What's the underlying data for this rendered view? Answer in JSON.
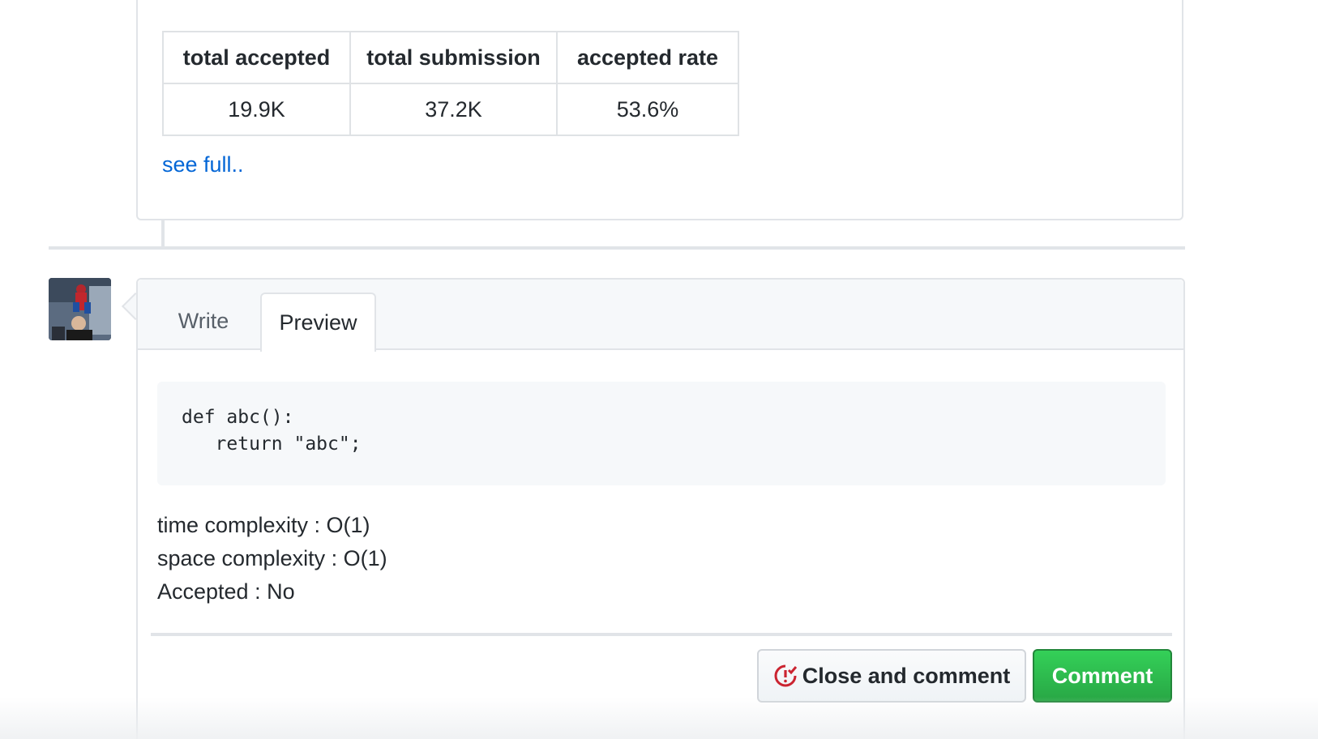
{
  "stats_table": {
    "headers": [
      "total accepted",
      "total submission",
      "accepted rate"
    ],
    "values": [
      "19.9K",
      "37.2K",
      "53.6%"
    ]
  },
  "see_full_link": "see full..",
  "comment_form": {
    "tabs": [
      "Write",
      "Preview"
    ],
    "active_tab": "Preview",
    "preview": {
      "code": "def abc():\n   return \"abc\";",
      "lines": [
        "time complexity : O(1)",
        "space complexity : O(1)",
        "Accepted : No"
      ]
    },
    "buttons": {
      "close_and_comment": "Close and comment",
      "comment": "Comment"
    }
  },
  "colors": {
    "link": "#0366d6",
    "comment_button": "#28a745",
    "close_icon": "#cb2431"
  }
}
